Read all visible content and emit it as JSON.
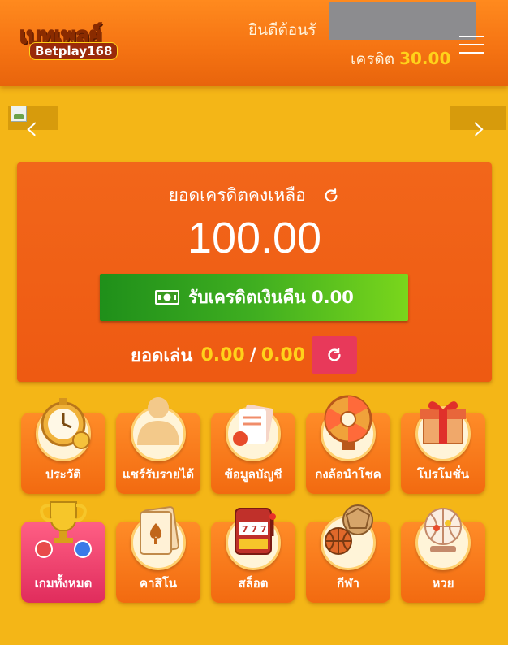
{
  "header": {
    "logo_text": "เบทเพลย์",
    "logo_sub": "Betplay168",
    "welcome": "ยินดีต้อนรั",
    "credit_label": "เครดิต",
    "credit_value": "30.00"
  },
  "banner": {
    "prev_arrow": "‹",
    "next_arrow": "›"
  },
  "balance_card": {
    "title": "ยอดเครดิตคงเหลือ",
    "amount": "100.00",
    "cashback_label": "รับเครดิตเงินคืน 0.00",
    "turnover_label": "ยอดเล่น",
    "turnover_current": "0.00",
    "turnover_sep": "/",
    "turnover_target": "0.00"
  },
  "menu": [
    {
      "label": "ประวัติ",
      "icon": "clock-icon"
    },
    {
      "label": "แชร์รับรายได้",
      "icon": "user-icon"
    },
    {
      "label": "ข้อมูลบัญชี",
      "icon": "account-docs-icon"
    },
    {
      "label": "กงล้อนำโชค",
      "icon": "wheel-icon"
    },
    {
      "label": "โปรโมชั่น",
      "icon": "gift-icon"
    },
    {
      "label": "เกมทั้งหมด",
      "icon": "trophy-icon"
    },
    {
      "label": "คาสิโน",
      "icon": "card-icon"
    },
    {
      "label": "สล็อต",
      "icon": "slot-machine-icon"
    },
    {
      "label": "กีฬา",
      "icon": "sports-ball-icon"
    },
    {
      "label": "หวย",
      "icon": "lottery-icon"
    }
  ],
  "colors": {
    "header": "#f47212",
    "background": "#f4b617",
    "card": "#ee5a12",
    "accent_yellow": "#ffd21a",
    "green_button": "#3fae20",
    "pink_button": "#e8395a"
  }
}
